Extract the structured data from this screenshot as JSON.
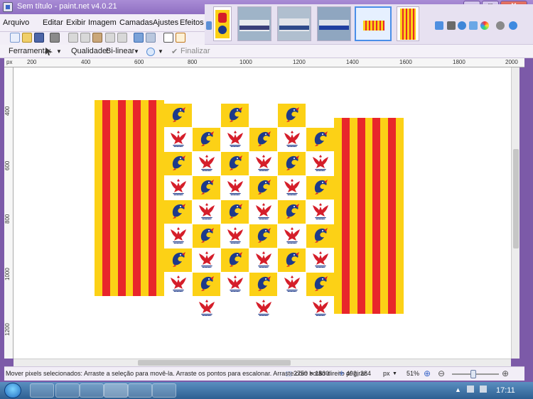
{
  "window": {
    "title": "Sem título - paint.net v4.0.21",
    "minimize_label": "─",
    "maximize_label": "□",
    "close_label": "✕"
  },
  "menu": {
    "items": [
      "Arquivo",
      "Editar",
      "Exibir",
      "Imagem",
      "Camadas",
      "Ajustes",
      "Efeitos"
    ]
  },
  "toolbar2": {
    "tool_label": "Ferramenta:",
    "quality_label": "Qualidade:",
    "quality_value": "Bi-linear",
    "finalize_label": "Finalizar"
  },
  "ruler": {
    "unit": "px",
    "top_labels": [
      "200",
      "400",
      "600",
      "800",
      "1000",
      "1200",
      "1400",
      "1600",
      "1800",
      "2000"
    ],
    "left_labels": [
      "400",
      "600",
      "800",
      "1000",
      "1200"
    ]
  },
  "status": {
    "message": "Mover pixels selecionados: Arraste a seleção para movê-la. Arraste os pontos para escalonar. Arraste com botão direito p/ girar.",
    "image_size": "2750 × 1830",
    "cursor_pos": "492, 284",
    "unit": "px",
    "zoom": "51%"
  },
  "taskbar": {
    "clock": "17:11"
  },
  "colors": {
    "flag_yellow": "#fcd116",
    "flag_red": "#e8262b",
    "dolphin_blue": "#1d3a8a",
    "eagle_red": "#d51e2a"
  }
}
